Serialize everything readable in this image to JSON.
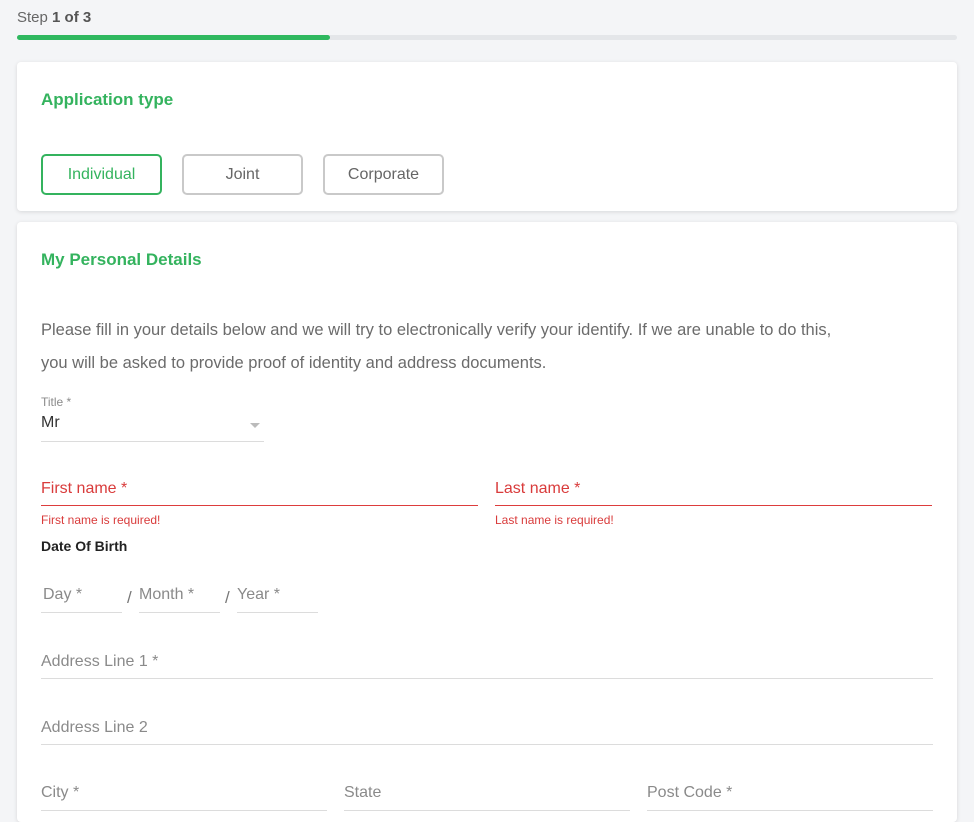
{
  "progress": {
    "step_prefix": "Step",
    "step_value": "1 of 3",
    "fraction": 0.333
  },
  "application_type": {
    "title": "Application type",
    "options": [
      "Individual",
      "Joint",
      "Corporate"
    ],
    "selected": "Individual"
  },
  "personal_details": {
    "title": "My Personal Details",
    "intro_line1": "Please fill in your details below and we will try to electronically verify your identify. If we are unable to do this,",
    "intro_line2": "you will be asked to provide proof of identity and address documents.",
    "title_field": {
      "label": "Title *",
      "value": "Mr"
    },
    "first_name": {
      "placeholder": "First name *",
      "error": "First name is required!"
    },
    "last_name": {
      "placeholder": "Last name *",
      "error": "Last name is required!"
    },
    "dob": {
      "label": "Date Of Birth",
      "day": "Day *",
      "month": "Month *",
      "year": "Year *",
      "separator": "/"
    },
    "address_line1": "Address Line 1 *",
    "address_line2": "Address Line 2",
    "city": "City *",
    "state": "State",
    "post_code": "Post Code *"
  },
  "colors": {
    "accent": "#34b35e",
    "error": "#d93b3b"
  }
}
